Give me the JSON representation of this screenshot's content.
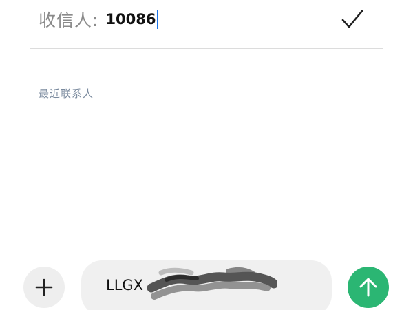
{
  "recipient": {
    "label": "收信人:",
    "value": "10086"
  },
  "recent_contacts": {
    "heading": "最近联系人"
  },
  "composer": {
    "message_text": "LLGX"
  },
  "icons": {
    "confirm": "checkmark-icon",
    "add": "plus-icon",
    "send": "arrow-up-icon"
  },
  "colors": {
    "send_button": "#2bb673",
    "caret": "#1a73e8",
    "section_heading": "#7a8a9e"
  }
}
